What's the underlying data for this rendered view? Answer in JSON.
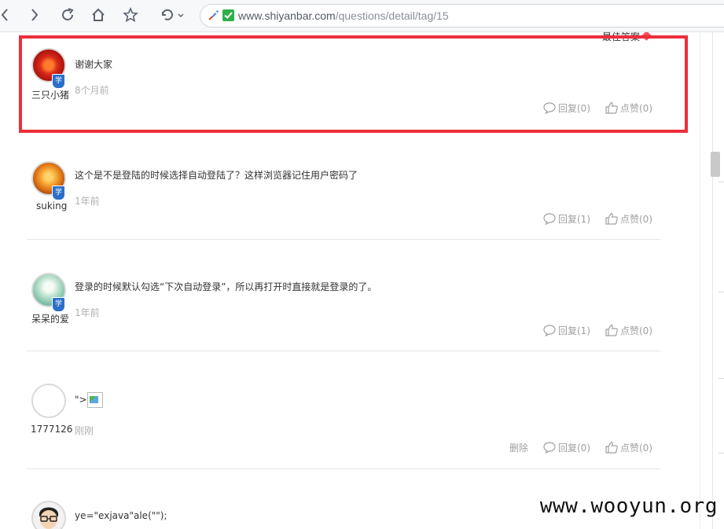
{
  "browser": {
    "url_host": "www.shiyanbar.com",
    "url_path": "/questions/detail/tag/15"
  },
  "top_partial_text": "最佳答案",
  "badge_label": "学",
  "comments": [
    {
      "user": "三只小猪",
      "text": "谢谢大家",
      "time": "8个月前",
      "reply": "回复(0)",
      "like": "点赞(0)",
      "avatar_color": "#c81e10"
    },
    {
      "user": "suking",
      "text": "这个是不是登陆的时候选择自动登陆了？这样浏览器记住用户密码了",
      "time": "1年前",
      "reply": "回复(1)",
      "like": "点赞(0)",
      "avatar_color": "#e07a10"
    },
    {
      "user": "呆呆的爱",
      "text": "登录的时候默认勾选“下次自动登录”，所以再打开时直接就是登录的了。",
      "time": "1年前",
      "reply": "回复(1)",
      "like": "点赞(0)",
      "avatar_color": "#7cc0a8"
    },
    {
      "user": "1777126",
      "text_prefix": "\">",
      "time": "刚刚",
      "delete": "删除",
      "reply": "回复(0)",
      "like": "点赞(0)"
    },
    {
      "text": "ye=\"exjava\"ale(\"\");"
    }
  ],
  "watermark": "www.wooyun.org"
}
